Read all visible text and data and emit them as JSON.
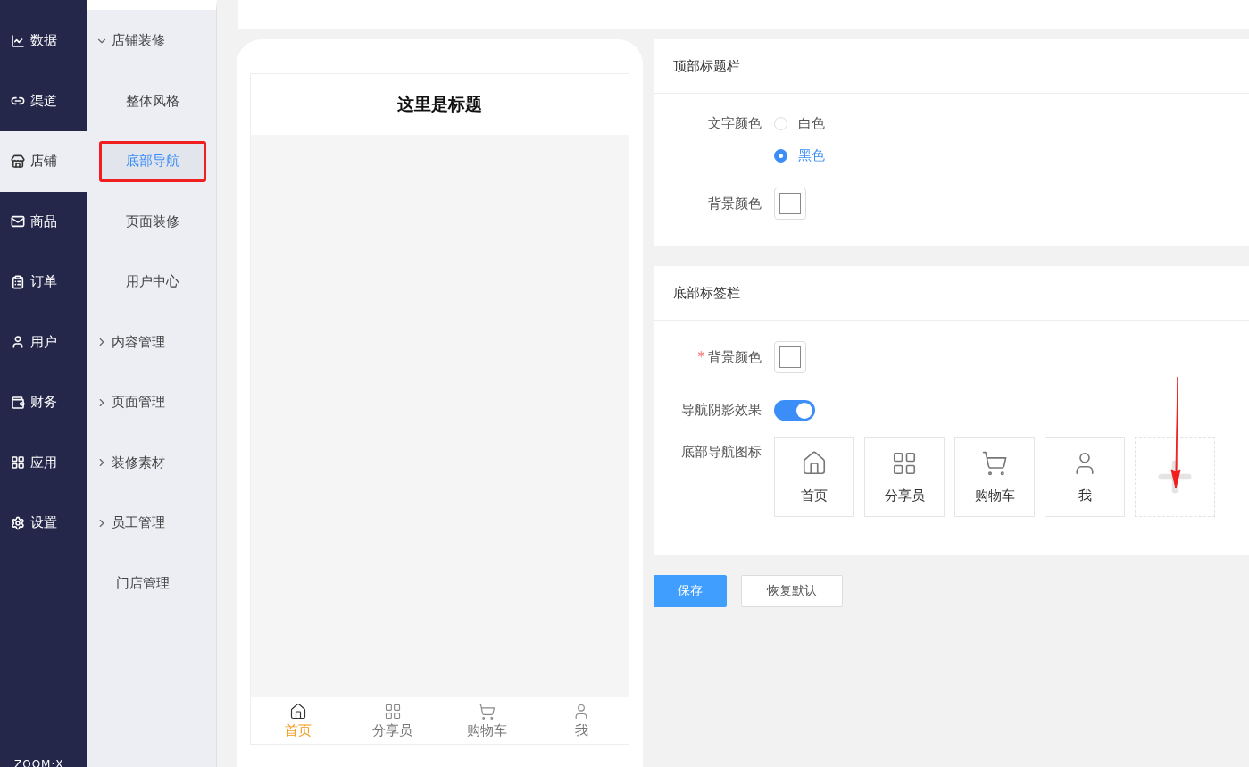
{
  "main_nav": [
    {
      "label": "数据",
      "kind": "chart",
      "selected": false
    },
    {
      "label": "渠道",
      "kind": "link",
      "selected": false
    },
    {
      "label": "店铺",
      "kind": "store",
      "selected": true
    },
    {
      "label": "商品",
      "kind": "mail",
      "selected": false
    },
    {
      "label": "订单",
      "kind": "clipboard",
      "selected": false
    },
    {
      "label": "用户",
      "kind": "user",
      "selected": false
    },
    {
      "label": "财务",
      "kind": "wallet",
      "selected": false
    },
    {
      "label": "应用",
      "kind": "apps",
      "selected": false
    },
    {
      "label": "设置",
      "kind": "settings",
      "selected": false
    }
  ],
  "logo": "ZOOM·X",
  "sub_nav": [
    {
      "kind": "group",
      "label": "店铺装修",
      "expanded": true,
      "children": [
        {
          "label": "整体风格",
          "selected": false,
          "annotated": false
        },
        {
          "label": "底部导航",
          "selected": true,
          "annotated": true
        },
        {
          "label": "页面装修",
          "selected": false,
          "annotated": false
        },
        {
          "label": "用户中心",
          "selected": false,
          "annotated": false
        }
      ]
    },
    {
      "kind": "group",
      "label": "内容管理",
      "expanded": false
    },
    {
      "kind": "group",
      "label": "页面管理",
      "expanded": false
    },
    {
      "kind": "group",
      "label": "装修素材",
      "expanded": false
    },
    {
      "kind": "group",
      "label": "员工管理",
      "expanded": false
    },
    {
      "kind": "link",
      "label": "门店管理"
    }
  ],
  "preview": {
    "title": "这里是标题",
    "tabs": [
      {
        "label": "首页",
        "kind": "home",
        "selected": true
      },
      {
        "label": "分享员",
        "kind": "grid",
        "selected": false
      },
      {
        "label": "购物车",
        "kind": "cart",
        "selected": false
      },
      {
        "label": "我",
        "kind": "user",
        "selected": false
      }
    ]
  },
  "top_bar_panel": {
    "title": "顶部标题栏",
    "text_color_label": "文字颜色",
    "text_color_options": [
      {
        "label": "白色",
        "selected": false
      },
      {
        "label": "黑色",
        "selected": true
      }
    ],
    "bg_color_label": "背景颜色"
  },
  "tab_bar_panel": {
    "title": "底部标签栏",
    "bg_color_label": "背景颜色",
    "required_mark": "*",
    "shadow_label": "导航阴影效果",
    "shadow_on": true,
    "icons_label": "底部导航图标",
    "icons": [
      {
        "label": "首页",
        "kind": "home"
      },
      {
        "label": "分享员",
        "kind": "grid"
      },
      {
        "label": "购物车",
        "kind": "cart"
      },
      {
        "label": "我",
        "kind": "user"
      }
    ]
  },
  "buttons": [
    {
      "label": "保存",
      "kind": "primary"
    },
    {
      "label": "恢复默认",
      "kind": "default"
    }
  ]
}
